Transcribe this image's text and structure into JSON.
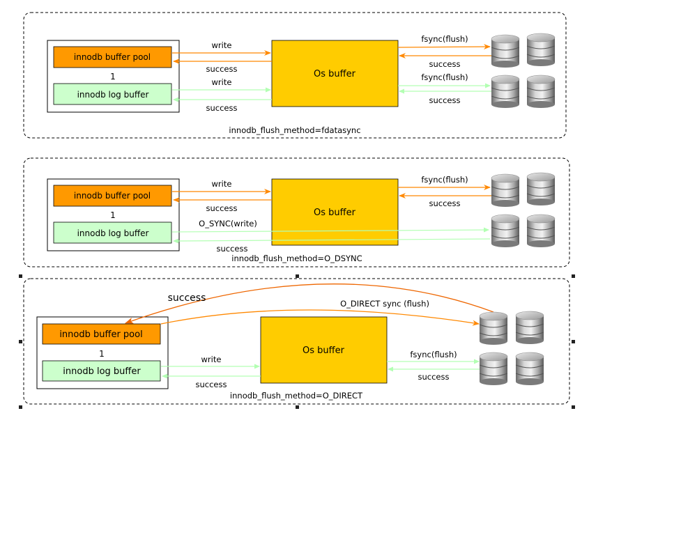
{
  "panels": [
    {
      "id": "fdatasync",
      "caption": "innodb_flush_method=fdatasync",
      "buffer_pool_label": "innodb buffer pool",
      "log_buffer_label": "innodb log buffer",
      "group_number": "1",
      "os_buffer_label": "Os buffer",
      "pool_write_label": "write",
      "pool_success_label": "success",
      "log_write_label": "write",
      "log_success_label": "success",
      "disk_top_flush_label": "fsync(flush)",
      "disk_top_success_label": "success",
      "disk_bottom_flush_label": "fsync(flush)",
      "disk_bottom_success_label": "success"
    },
    {
      "id": "o_dsync",
      "caption": "innodb_flush_method=O_DSYNC",
      "buffer_pool_label": "innodb buffer pool",
      "log_buffer_label": "innodb log buffer",
      "group_number": "1",
      "os_buffer_label": "Os buffer",
      "pool_write_label": "write",
      "pool_success_label": "success",
      "log_write_label": "O_SYNC(write)",
      "log_success_label": "success",
      "disk_top_flush_label": "fsync(flush)",
      "disk_top_success_label": "success"
    },
    {
      "id": "o_direct",
      "caption": "innodb_flush_method=O_DIRECT",
      "buffer_pool_label": "innodb buffer pool",
      "log_buffer_label": "innodb log buffer",
      "group_number": "1",
      "os_buffer_label": "Os buffer",
      "direct_label": "O_DIRECT   sync (flush)",
      "direct_success_label": "success",
      "log_write_label": "write",
      "log_success_label": "success",
      "disk_bottom_flush_label": "fsync(flush)",
      "disk_bottom_success_label": "success"
    }
  ],
  "colors": {
    "buffer_pool_fill": "#ff9900",
    "log_buffer_fill": "#ccffcc",
    "os_buffer_fill": "#ffcc00",
    "pool_arrow": "#ff8800",
    "log_arrow": "#b3ffb3",
    "direct_arrow": "#ff7700",
    "panel_border": "#000000"
  },
  "icons": {
    "disk": "database-cylinder-icon"
  }
}
